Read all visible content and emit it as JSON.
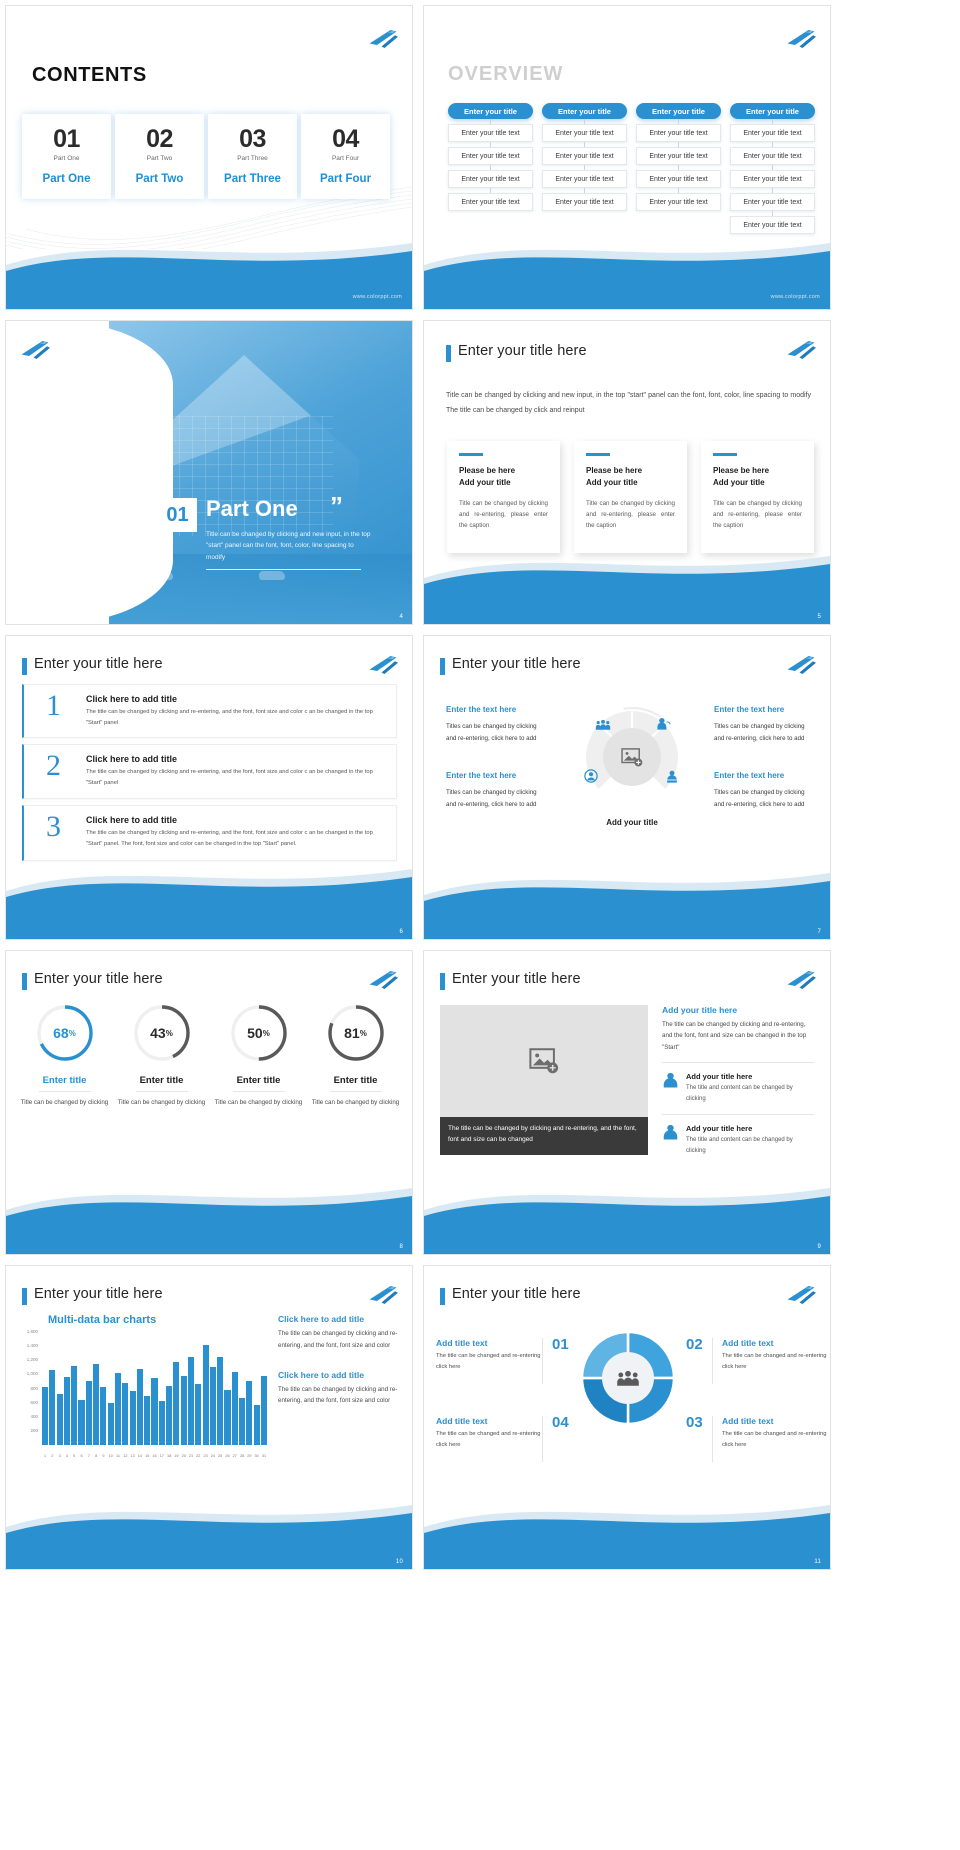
{
  "brand": {
    "accent": "#2b90d0",
    "dark": "#3a3a3a",
    "grey": "#cfcfcf"
  },
  "site_url": "www.colorppt.com",
  "slide1": {
    "title": "CONTENTS",
    "cards": [
      {
        "num": "01",
        "sub": "Part One",
        "name": "Part One"
      },
      {
        "num": "02",
        "sub": "Part Two",
        "name": "Part Two"
      },
      {
        "num": "03",
        "sub": "Part Three",
        "name": "Part Three"
      },
      {
        "num": "04",
        "sub": "Part Four",
        "name": "Part Four"
      }
    ]
  },
  "slide2": {
    "title": "OVERVIEW",
    "columns": [
      {
        "pill": "Enter your title",
        "items": [
          "Enter your title text",
          "Enter your title text",
          "Enter your title text",
          "Enter your title text"
        ]
      },
      {
        "pill": "Enter your title",
        "items": [
          "Enter your title text",
          "Enter your title text",
          "Enter your title text",
          "Enter your title text"
        ]
      },
      {
        "pill": "Enter your title",
        "items": [
          "Enter your title text",
          "Enter your title text",
          "Enter your title text",
          "Enter your title text"
        ]
      },
      {
        "pill": "Enter your title",
        "items": [
          "Enter your title text",
          "Enter your title text",
          "Enter your title text",
          "Enter your title text",
          "Enter your title text"
        ]
      }
    ]
  },
  "slide3": {
    "number": "01",
    "heading": "Part One",
    "quote": "”",
    "body": "Title can be changed by clicking and new input, in the top \"start\" panel can the font, font, color, line spacing to modify",
    "page": "4"
  },
  "slide4": {
    "title": "Enter your title here",
    "paragraph": "Title can be changed by clicking and new input, in the top \"start\" panel can the font, font, color, line spacing to modify The title can be changed by click and reinput",
    "cards": [
      {
        "heading": "Please be here\nAdd your title",
        "text": "Title can be changed by clicking and re-entering, please enter the caption"
      },
      {
        "heading": "Please be here\nAdd your title",
        "text": "Title can be changed by clicking and re-entering, please enter the caption"
      },
      {
        "heading": "Please be here\nAdd your title",
        "text": "Title can be changed by clicking and re-entering, please enter the caption"
      }
    ],
    "page": "5"
  },
  "slide5": {
    "title": "Enter your title here",
    "rows": [
      {
        "num": "1",
        "heading": "Click here to add title",
        "text": "The title can be changed by clicking and re-entering, and the font, font size and color c an be changed in the top \"Start\" panel"
      },
      {
        "num": "2",
        "heading": "Click here to add title",
        "text": "The title can be changed by clicking and re-entering, and the font, font size and color c an be changed in the top \"Start\" panel"
      },
      {
        "num": "3",
        "heading": "Click here to add title",
        "text": "The title can be changed by clicking and re-entering, and the font, font size and color c an be changed in the top \"Start\" panel. The font, font size and color can be changed in the top \"Start\" panel."
      }
    ],
    "page": "6"
  },
  "slide6": {
    "title": "Enter your title here",
    "center_label": "Add your title",
    "blocks": [
      {
        "heading": "Enter the text here",
        "text": "Titles can be changed by clicking and re-entering, click here to add"
      },
      {
        "heading": "Enter the text here",
        "text": "Titles can be changed by clicking and re-entering, click here to add"
      },
      {
        "heading": "Enter the text here",
        "text": "Titles can be changed by clicking and re-entering, click here to add"
      },
      {
        "heading": "Enter the text here",
        "text": "Titles can be changed by clicking and re-entering, click here to add"
      }
    ],
    "icons": [
      "group-people-icon",
      "headset-person-icon",
      "person-circle-icon",
      "person-book-icon",
      "image-placeholder-icon"
    ],
    "page": "7"
  },
  "slide7": {
    "title": "Enter your title here",
    "rings": [
      {
        "value": 68,
        "value_label": "68",
        "unit": "%",
        "heading": "Enter title",
        "text": "Title can be changed by clicking",
        "color": "#2b90d0"
      },
      {
        "value": 43,
        "value_label": "43",
        "unit": "%",
        "heading": "Enter title",
        "text": "Title can be changed by clicking",
        "color": "#595959"
      },
      {
        "value": 50,
        "value_label": "50",
        "unit": "%",
        "heading": "Enter title",
        "text": "Title can be changed by clicking",
        "color": "#595959"
      },
      {
        "value": 81,
        "value_label": "81",
        "unit": "%",
        "heading": "Enter title",
        "text": "Title can be changed by clicking",
        "color": "#595959"
      }
    ],
    "page": "8"
  },
  "slide8": {
    "title": "Enter your title here",
    "photo_icon": "image-placeholder-icon",
    "caption": "The title can be changed by clicking and re-entering, and the font, font and size can be changed",
    "lead_heading": "Add your title here",
    "lead_text": "The title can be changed by clicking and re-entering, and the font, font and size can be changed in the top \"Start\"",
    "rows": [
      {
        "icon": "person-icon",
        "heading": "Add your title here",
        "text": "The title and content can be changed by clicking"
      },
      {
        "icon": "person-icon",
        "heading": "Add your title here",
        "text": "The title and content can be changed by clicking"
      }
    ],
    "page": "9"
  },
  "slide9": {
    "title": "Enter your title here",
    "blocks": [
      {
        "heading": "Click here to add title",
        "text": "The title can be changed by clicking and re-entering, and the font, font size and color"
      },
      {
        "heading": "Click here to add title",
        "text": "The title can be changed by clicking and re-entering, and the font, font size and color"
      }
    ],
    "page": "10"
  },
  "slide10": {
    "title": "Enter your title here",
    "arc_labels": [
      "Add title text",
      "Add title text",
      "Add title text",
      "Add title text"
    ],
    "cells": [
      {
        "num": "01",
        "heading": "Add title text",
        "text": "The title can be changed and re-entering click here"
      },
      {
        "num": "02",
        "heading": "Add title text",
        "text": "The title can be changed and re-entering click here"
      },
      {
        "num": "03",
        "heading": "Add title text",
        "text": "The title can be changed and re-entering click here"
      },
      {
        "num": "04",
        "heading": "Add title text",
        "text": "The title can be changed and re-entering click here"
      }
    ],
    "center_icon": "group-people-icon",
    "page": "11"
  },
  "chart_data": {
    "type": "bar",
    "title": "Multi-data bar charts",
    "xlabel": "",
    "ylabel": "",
    "ylim": [
      0,
      1600
    ],
    "yticks": [
      0,
      200,
      400,
      600,
      800,
      1000,
      1200,
      1400,
      1600
    ],
    "ytick_labels": [
      "0",
      "200",
      "400",
      "600",
      "800",
      "1,000",
      "1,200",
      "1,400",
      "1,600"
    ],
    "grid": false,
    "categories": [
      "1",
      "2",
      "3",
      "4",
      "5",
      "6",
      "7",
      "8",
      "9",
      "10",
      "11",
      "12",
      "13",
      "14",
      "15",
      "16",
      "17",
      "18",
      "19",
      "20",
      "21",
      "22",
      "23",
      "24",
      "25",
      "26",
      "27",
      "28",
      "29",
      "30",
      "31"
    ],
    "values": [
      820,
      1060,
      720,
      960,
      1120,
      640,
      900,
      1150,
      820,
      600,
      1020,
      880,
      760,
      1080,
      700,
      950,
      620,
      840,
      1180,
      980,
      1240,
      860,
      1420,
      1100,
      1240,
      780,
      1040,
      660,
      900,
      560,
      980
    ]
  }
}
